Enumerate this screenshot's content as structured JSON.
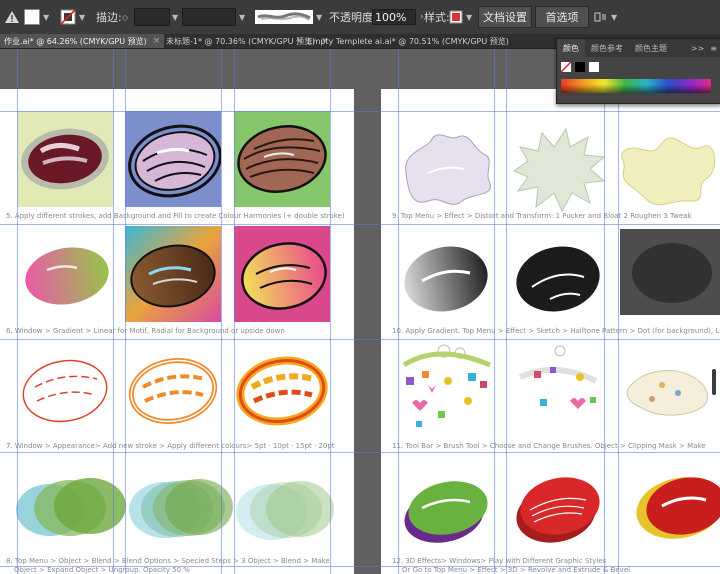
{
  "toolbar": {
    "stroke_label": "描边:",
    "opacity_label": "不透明度:",
    "opacity_value": "100%",
    "style_label": "样式:",
    "doc_settings": "文档设置",
    "preferences": "首选项"
  },
  "tabs": [
    {
      "label": "作业.ai* @ 64.26% (CMYK/GPU 预览)"
    },
    {
      "label": "未标题-1* @ 70.36% (CMYK/GPU 预览)"
    },
    {
      "label": "Empty Templete ai.ai* @ 70.51% (CMYK/GPU 预览)"
    }
  ],
  "panel": {
    "tabs": [
      "颜色",
      "颜色参考",
      "颜色主题"
    ],
    "collapse": ">>",
    "menu": "≡"
  },
  "captions": {
    "c5": "5. Apply different strokes, add Background and Fill to create Colour Harmonies (+ double stroke)",
    "c6": "6. Window > Gradient > Linear for Motif, Radial  for Background or upside down",
    "c7": "7. Window > Appearance> Add new stroke > Apply different colours> 5pt · 10pt · 15pt · 20pt",
    "c8a": "8. Top Menu > Object > Blend > Blend Options > Specied Steps > 3    Object > Blend > Make",
    "c8b": "Object > Expand   Object > Ungroup. Opacity 50 %",
    "c9": "9. Top Menu > Effect > Distort and Transform: 1 Pucker and Bloat  2 Roughen  3 Tweak",
    "c10": "10. Apply Gradient. Top Menu > Effect > Sketch > Halftone Pattern > Dot (for background), Line",
    "c11": "11. Tool Bar > Brush Tool > Choose and Change Brushes. Object > Clipping Mask > Make",
    "c12a": "12. 3D Effects> Windows> Play with Different Graphic Styles",
    "c12b": "Or Go to Top Menu > Effect > 3D >    Revolve and  Extrude & Bevel"
  }
}
